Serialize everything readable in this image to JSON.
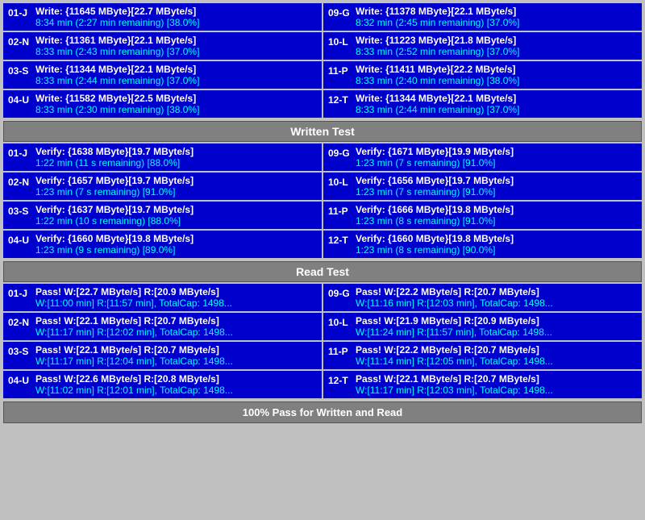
{
  "sections": {
    "write_test": {
      "label": "Written Test",
      "left_cells": [
        {
          "id": "01-J",
          "line1": "Write: {11645 MByte}[22.7 MByte/s]",
          "line2": "8:34 min (2:27 min remaining)  [38.0%]"
        },
        {
          "id": "02-N",
          "line1": "Write: {11361 MByte}[22.1 MByte/s]",
          "line2": "8:33 min (2:43 min remaining)  [37.0%]"
        },
        {
          "id": "03-S",
          "line1": "Write: {11344 MByte}[22.1 MByte/s]",
          "line2": "8:33 min (2:44 min remaining)  [37.0%]"
        },
        {
          "id": "04-U",
          "line1": "Write: {11582 MByte}[22.5 MByte/s]",
          "line2": "8:33 min (2:30 min remaining)  [38.0%]"
        }
      ],
      "right_cells": [
        {
          "id": "09-G",
          "line1": "Write: {11378 MByte}[22.1 MByte/s]",
          "line2": "8:32 min (2:45 min remaining)  [37.0%]"
        },
        {
          "id": "10-L",
          "line1": "Write: {11223 MByte}[21.8 MByte/s]",
          "line2": "8:33 min (2:52 min remaining)  [37.0%]"
        },
        {
          "id": "11-P",
          "line1": "Write: {11411 MByte}[22.2 MByte/s]",
          "line2": "8:33 min (2:40 min remaining)  [38.0%]"
        },
        {
          "id": "12-T",
          "line1": "Write: {11344 MByte}[22.1 MByte/s]",
          "line2": "8:33 min (2:44 min remaining)  [37.0%]"
        }
      ]
    },
    "verify_test": {
      "left_cells": [
        {
          "id": "01-J",
          "line1": "Verify: {1638 MByte}[19.7 MByte/s]",
          "line2": "1:22 min (11 s remaining)  [88.0%]"
        },
        {
          "id": "02-N",
          "line1": "Verify: {1657 MByte}[19.7 MByte/s]",
          "line2": "1:23 min (7 s remaining)  [91.0%]"
        },
        {
          "id": "03-S",
          "line1": "Verify: {1637 MByte}[19.7 MByte/s]",
          "line2": "1:22 min (10 s remaining)  [88.0%]"
        },
        {
          "id": "04-U",
          "line1": "Verify: {1660 MByte}[19.8 MByte/s]",
          "line2": "1:23 min (9 s remaining)  [89.0%]"
        }
      ],
      "right_cells": [
        {
          "id": "09-G",
          "line1": "Verify: {1671 MByte}[19.9 MByte/s]",
          "line2": "1:23 min (7 s remaining)  [91.0%]"
        },
        {
          "id": "10-L",
          "line1": "Verify: {1656 MByte}[19.7 MByte/s]",
          "line2": "1:23 min (7 s remaining)  [91.0%]"
        },
        {
          "id": "11-P",
          "line1": "Verify: {1666 MByte}[19.8 MByte/s]",
          "line2": "1:23 min (8 s remaining)  [91.0%]"
        },
        {
          "id": "12-T",
          "line1": "Verify: {1660 MByte}[19.8 MByte/s]",
          "line2": "1:23 min (8 s remaining)  [90.0%]"
        }
      ]
    },
    "read_test": {
      "label": "Read Test",
      "left_cells": [
        {
          "id": "01-J",
          "line1": "Pass! W:[22.7 MByte/s] R:[20.9 MByte/s]",
          "line2": "W:[11:00 min] R:[11:57 min], TotalCap: 1498..."
        },
        {
          "id": "02-N",
          "line1": "Pass! W:[22.1 MByte/s] R:[20.7 MByte/s]",
          "line2": "W:[11:17 min] R:[12:02 min], TotalCap: 1498..."
        },
        {
          "id": "03-S",
          "line1": "Pass! W:[22.1 MByte/s] R:[20.7 MByte/s]",
          "line2": "W:[11:17 min] R:[12:04 min], TotalCap: 1498..."
        },
        {
          "id": "04-U",
          "line1": "Pass! W:[22.6 MByte/s] R:[20.8 MByte/s]",
          "line2": "W:[11:02 min] R:[12:01 min], TotalCap: 1498..."
        }
      ],
      "right_cells": [
        {
          "id": "09-G",
          "line1": "Pass! W:[22.2 MByte/s] R:[20.7 MByte/s]",
          "line2": "W:[11:16 min] R:[12:03 min], TotalCap: 1498..."
        },
        {
          "id": "10-L",
          "line1": "Pass! W:[21.9 MByte/s] R:[20.9 MByte/s]",
          "line2": "W:[11:24 min] R:[11:57 min], TotalCap: 1498..."
        },
        {
          "id": "11-P",
          "line1": "Pass! W:[22.2 MByte/s] R:[20.7 MByte/s]",
          "line2": "W:[11:14 min] R:[12:05 min], TotalCap: 1498..."
        },
        {
          "id": "12-T",
          "line1": "Pass! W:[22.1 MByte/s] R:[20.7 MByte/s]",
          "line2": "W:[11:17 min] R:[12:03 min], TotalCap: 1498..."
        }
      ]
    }
  },
  "headers": {
    "written_test": "Written Test",
    "read_test": "Read Test"
  },
  "footer": "100% Pass for Written and Read"
}
